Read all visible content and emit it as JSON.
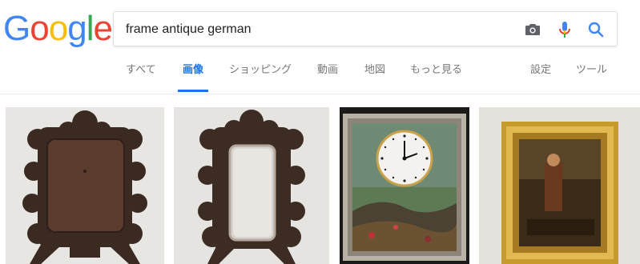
{
  "logo": {
    "letters": [
      "G",
      "o",
      "o",
      "g",
      "l",
      "e"
    ],
    "colors": [
      "#4285f4",
      "#ea4335",
      "#fbbc05",
      "#4285f4",
      "#34a853",
      "#ea4335"
    ]
  },
  "search": {
    "query": "frame antique german",
    "camera_icon": "camera-icon",
    "mic_icon": "microphone-icon",
    "search_icon": "search-icon"
  },
  "tabs": [
    {
      "label": "すべて"
    },
    {
      "label": "画像"
    },
    {
      "label": "ショッピング"
    },
    {
      "label": "動画"
    },
    {
      "label": "地図"
    },
    {
      "label": "もっと見る"
    }
  ],
  "tools": {
    "settings": "設定",
    "tools": "ツール"
  },
  "results": [
    {
      "name": "carved-wood-frame-back"
    },
    {
      "name": "carved-wood-frame-mirror"
    },
    {
      "name": "painting-clock"
    },
    {
      "name": "gilt-framed-painting"
    }
  ],
  "colors": {
    "accent": "#1a73e8",
    "tab_text": "#777777",
    "border": "#dfe1e5"
  }
}
